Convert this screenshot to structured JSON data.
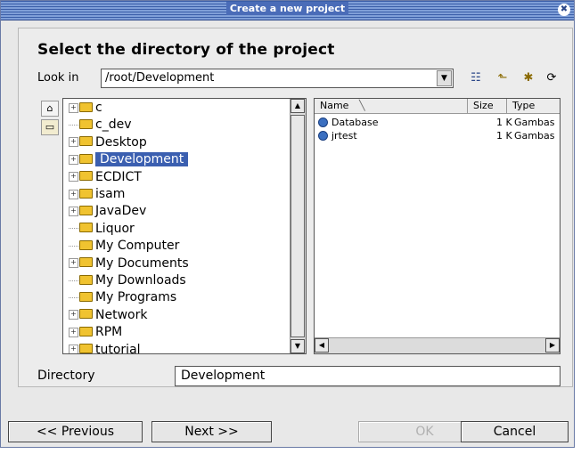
{
  "window": {
    "title": "Create a new project",
    "close_glyph": "✖"
  },
  "heading": "Select the directory of the project",
  "look_in": {
    "label": "Look in",
    "path": "/root/Development",
    "arrow_glyph": "▼"
  },
  "toolbar_icons": [
    "detail-view-icon",
    "parent-folder-icon",
    "new-folder-icon",
    "refresh-icon"
  ],
  "toolbar_glyphs": [
    "☷",
    "⬑",
    "✱",
    "⟳"
  ],
  "side_icons": {
    "home_glyph": "⌂",
    "folder_glyph": "▭"
  },
  "tree": {
    "items": [
      {
        "label": "c",
        "expandable": true,
        "selected": false
      },
      {
        "label": "c_dev",
        "expandable": false,
        "selected": false
      },
      {
        "label": "Desktop",
        "expandable": true,
        "selected": false
      },
      {
        "label": "Development",
        "expandable": true,
        "selected": true
      },
      {
        "label": "ECDICT",
        "expandable": true,
        "selected": false
      },
      {
        "label": "isam",
        "expandable": true,
        "selected": false
      },
      {
        "label": "JavaDev",
        "expandable": true,
        "selected": false
      },
      {
        "label": "Liquor",
        "expandable": false,
        "selected": false
      },
      {
        "label": "My Computer",
        "expandable": false,
        "selected": false
      },
      {
        "label": "My Documents",
        "expandable": true,
        "selected": false
      },
      {
        "label": "My Downloads",
        "expandable": false,
        "selected": false
      },
      {
        "label": "My Programs",
        "expandable": false,
        "selected": false
      },
      {
        "label": "Network",
        "expandable": true,
        "selected": false
      },
      {
        "label": "RPM",
        "expandable": true,
        "selected": false
      },
      {
        "label": "tutorial",
        "expandable": true,
        "selected": false
      }
    ],
    "expand_glyph": "+",
    "scroll_up_glyph": "▲",
    "scroll_down_glyph": "▼"
  },
  "files": {
    "columns": {
      "name": "Name",
      "size": "Size",
      "type": "Type"
    },
    "sort_glyph": "╲",
    "rows": [
      {
        "name": "Database",
        "size": "1 K",
        "type": "Gambas"
      },
      {
        "name": "jrtest",
        "size": "1 K",
        "type": "Gambas"
      }
    ],
    "scroll_left_glyph": "◀",
    "scroll_right_glyph": "▶"
  },
  "directory": {
    "label": "Directory",
    "value": "Development"
  },
  "buttons": {
    "previous": "<< Previous",
    "next": "Next >>",
    "ok": "OK",
    "cancel": "Cancel"
  },
  "colors": {
    "title_bar": "#4a6cb8",
    "selection": "#3b5fb0",
    "folder": "#f0c330"
  }
}
